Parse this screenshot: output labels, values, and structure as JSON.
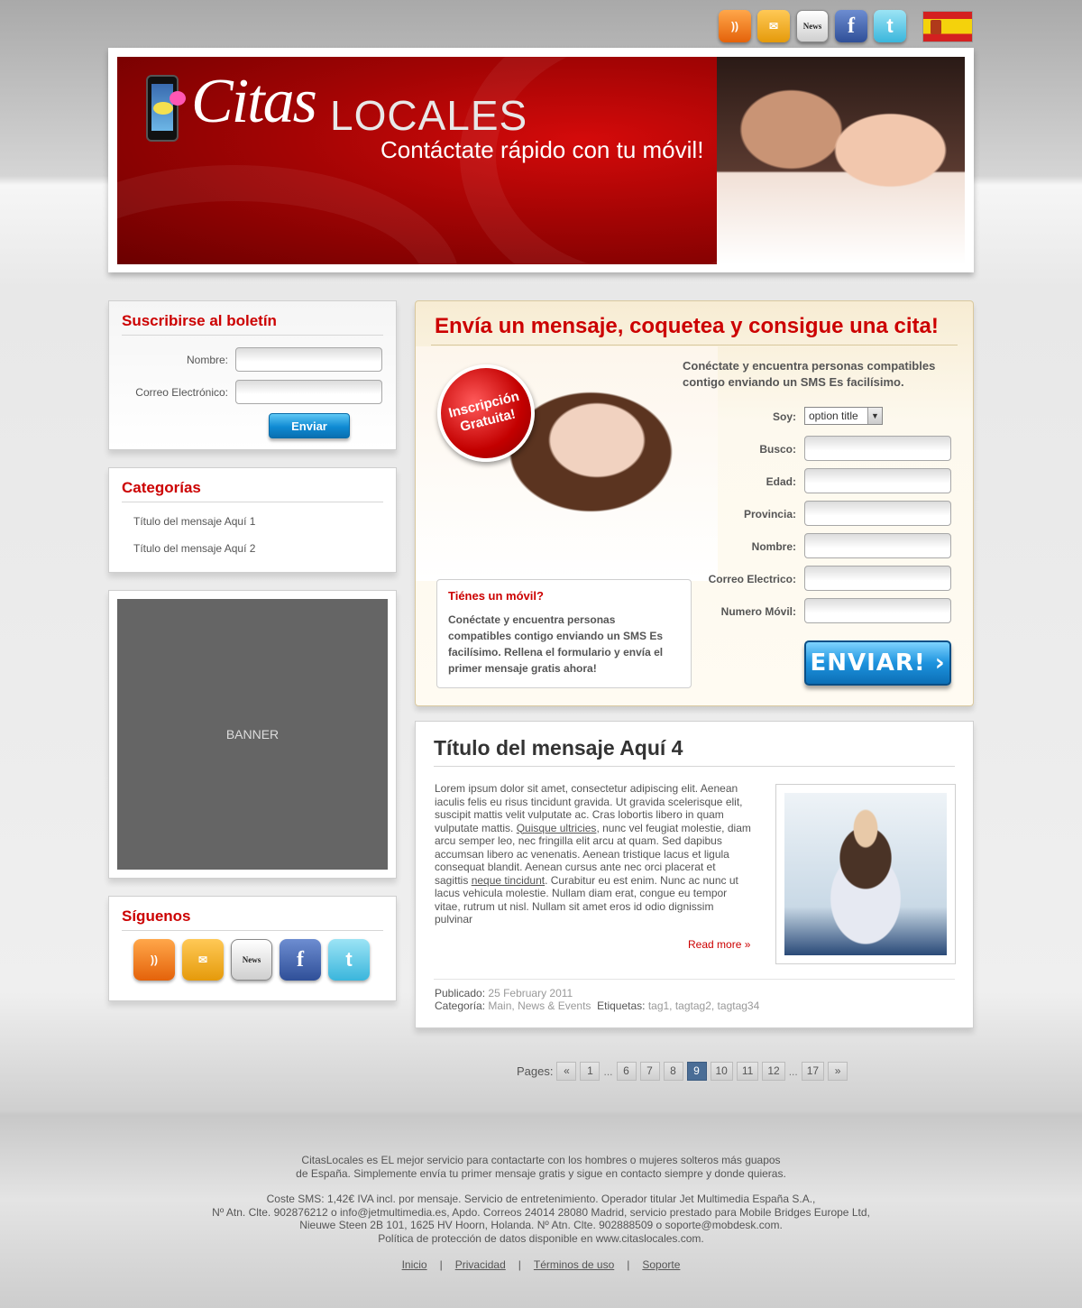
{
  "top_icons": [
    {
      "name": "rss-icon",
      "glyph": "))"
    },
    {
      "name": "mail-icon",
      "glyph": "✉"
    },
    {
      "name": "news-icon",
      "glyph": "News"
    },
    {
      "name": "facebook-icon",
      "glyph": "f"
    },
    {
      "name": "twitter-icon",
      "glyph": "t"
    }
  ],
  "header": {
    "logo_citas": "Citas",
    "logo_locales": "LOCALES",
    "tagline": "Contáctate rápido con tu móvil!"
  },
  "newsletter": {
    "title": "Suscribirse al boletín",
    "name_label": "Nombre:",
    "email_label": "Correo Electrónico:",
    "submit_label": "Enviar"
  },
  "categories": {
    "title": "Categorías",
    "items": [
      "Título del mensaje Aquí 1",
      "Título del mensaje Aquí 2"
    ]
  },
  "banner": {
    "label": "BANNER"
  },
  "follow": {
    "title": "Síguenos"
  },
  "signup": {
    "title": "Envía un mensaje, coquetea y consigue una cita!",
    "badge_line1": "Inscripción",
    "badge_line2": "Gratuita!",
    "intro": "Conéctate y encuentra personas compatibles contigo enviando un SMS Es facilísimo.",
    "soy_label": "Soy:",
    "soy_value": "option title",
    "busco_label": "Busco:",
    "edad_label": "Edad:",
    "provincia_label": "Provincia:",
    "nombre_label": "Nombre:",
    "correo_label": "Correo Electrico:",
    "movil_label": "Numero Móvil:",
    "submit_label": "ENVIAR! ›",
    "mobile_box": {
      "title": "Tiénes un móvil?",
      "text": "Conéctate y encuentra personas compatibles contigo enviando un SMS Es facilísimo. Rellena el formulario y envía el primer mensaje gratis ahora!"
    }
  },
  "post": {
    "title": "Título del mensaje Aquí 4",
    "body_1": "Lorem ipsum dolor sit amet, consectetur adipiscing elit. Aenean iaculis felis eu risus tincidunt gravida. Ut gravida scelerisque elit, suscipit mattis velit vulputate ac. Cras lobortis libero in quam vulputate mattis. ",
    "link_1": "Quisque ultricies",
    "body_2": ", nunc vel feugiat molestie, diam arcu semper leo, nec fringilla elit arcu at quam. Sed dapibus accumsan libero ac venenatis. Aenean tristique lacus et ligula consequat blandit. Aenean cursus ante nec orci placerat et sagittis ",
    "link_2": "neque tincidunt",
    "body_3": ". Curabitur eu est enim. Nunc ac nunc ut lacus vehicula molestie. Nullam diam erat, congue eu tempor vitae, rutrum ut nisl. Nullam sit amet eros id odio dignissim pulvinar",
    "read_more": "Read more »",
    "published_label": "Publicado:",
    "published_value": "25 February 2011",
    "category_label": "Categoría:",
    "category_value": "Main, News & Events",
    "tags_label": "Etiquetas:",
    "tags_value": "tag1, tagtag2, tagtag34"
  },
  "pagination": {
    "label": "Pages:",
    "prev": "«",
    "next": "»",
    "items": [
      "1",
      "...",
      "6",
      "7",
      "8",
      "9",
      "10",
      "11",
      "12",
      "...",
      "17"
    ],
    "current": "9"
  },
  "footer": {
    "line1": "CitasLocales es EL mejor servicio para contactarte con los hombres o mujeres solteros más guapos",
    "line2": "de España. Simplemente envía tu primer mensaje gratis y sigue en contacto siempre y donde quieras.",
    "line3": "Coste SMS: 1,42€ IVA incl. por mensaje. Servicio de entretenimiento. Operador titular Jet Multimedia España S.A.,",
    "line4": "Nº Atn. Clte. 902876212 o info@jetmultimedia.es, Apdo. Correos 24014 28080 Madrid, servicio prestado para Mobile Bridges Europe Ltd,",
    "line5": "Nieuwe Steen 2B 101, 1625 HV Hoorn, Holanda. Nº Atn. Clte. 902888509 o soporte@mobdesk.com.",
    "line6": "Política de protección de datos disponible en www.citaslocales.com.",
    "links": [
      "Inicio",
      "Privacidad",
      "Términos de uso",
      "Soporte"
    ]
  }
}
